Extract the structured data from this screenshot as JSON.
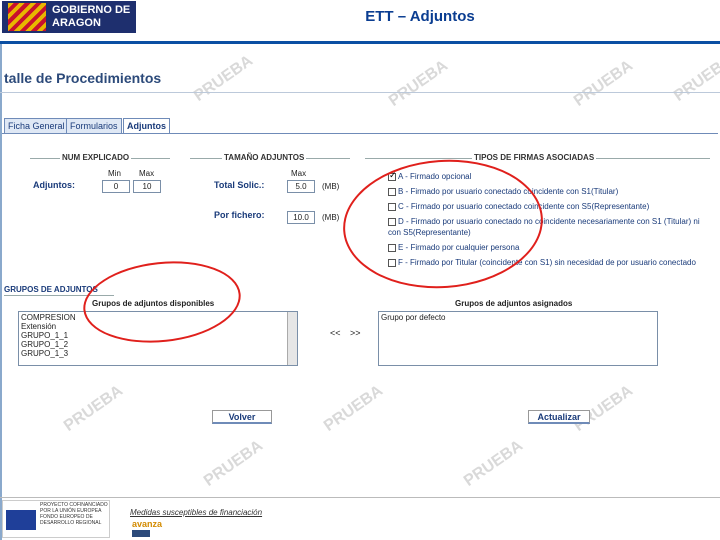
{
  "header": {
    "logo_text": "GOBIERNO DE ARAGON",
    "title": "ETT – Adjuntos"
  },
  "page_title": "talle de Procedimientos",
  "tabs": [
    {
      "label": "Ficha General"
    },
    {
      "label": "Formularios"
    },
    {
      "label": "Adjuntos"
    }
  ],
  "sections": {
    "num_explicado": "NUM EXPLICADO",
    "tamano": "TAMAÑO ADJUNTOS",
    "tipos": "TIPOS DE FIRMAS ASOCIADAS",
    "grupos": "GRUPOS DE ADJUNTOS"
  },
  "adjuntos": {
    "label": "Adjuntos:",
    "min_label": "Min",
    "max_label": "Max",
    "min_value": "0",
    "max_value": "10"
  },
  "tamano": {
    "total_label": "Total Solic.:",
    "max_label": "Max",
    "total_value": "5.0",
    "total_unit": "(MB)",
    "fichero_label": "Por fichero:",
    "fichero_value": "10.0",
    "fichero_unit": "(MB)"
  },
  "firmas": [
    {
      "label": "A - Firmado opcional",
      "checked": true
    },
    {
      "label": "B - Firmado por usuario conectado coincidente con S1(Titular)",
      "checked": false
    },
    {
      "label": "C - Firmado por usuario conectado coincidente con S5(Representante)",
      "checked": false
    },
    {
      "label": "D - Firmado por usuario conectado no coincidente necesariamente con S1 (Titular) ni con S5(Representante)",
      "checked": false
    },
    {
      "label": "E - Firmado por cualquier persona",
      "checked": false
    },
    {
      "label": "F - Firmado por Titular (coincidente con S1) sin necesidad de por usuario conectado",
      "checked": false
    }
  ],
  "grupos": {
    "disponibles_title": "Grupos de adjuntos disponibles",
    "asignados_title": "Grupos de adjuntos asignados",
    "disponibles": [
      "COMPRESION",
      "Extensión",
      "GRUPO_1_1",
      "GRUPO_1_2",
      "GRUPO_1_3"
    ],
    "asignados": [
      "Grupo por defecto"
    ],
    "move_left": "<<",
    "move_right": ">>"
  },
  "buttons": {
    "volver": "Volver",
    "actualizar": "Actualizar"
  },
  "watermark": "PRUEBA",
  "footer": {
    "eu_text": "PROYECTO COFINANCIADO POR LA UNIÓN EUROPEA  FONDO EUROPEO DE DESARROLLO REGIONAL",
    "financiacion": "Medidas susceptibles de financiación",
    "logo_text": "avanza"
  },
  "colors": {
    "accent": "#0a3d91",
    "highlight_oval": "#e0201c"
  }
}
